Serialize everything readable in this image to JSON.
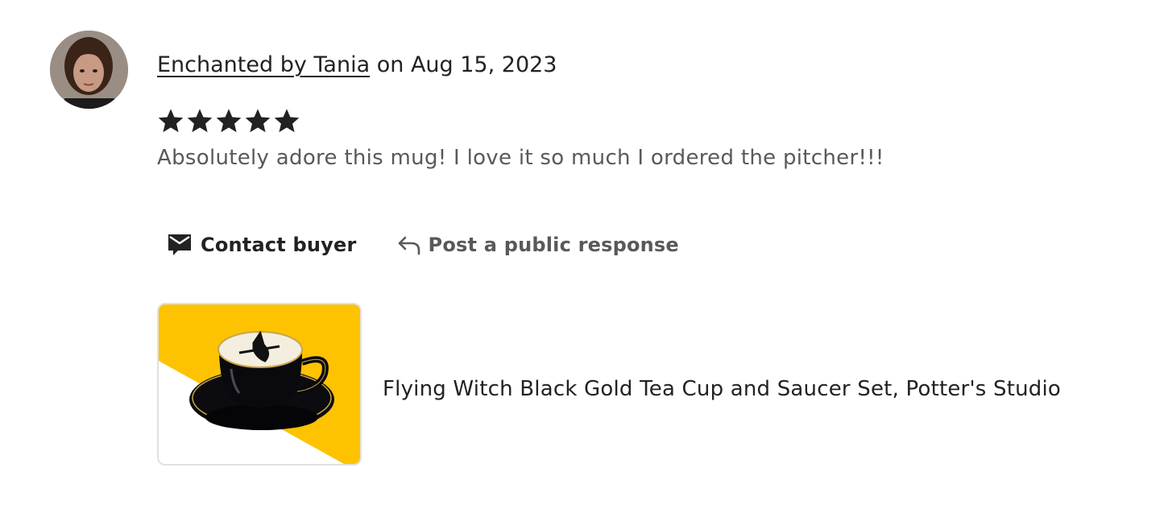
{
  "review": {
    "reviewer_name": "Enchanted by Tania",
    "date_text": "on Aug 15, 2023",
    "rating": 5,
    "rating_max": 5,
    "text": "Absolutely adore this mug! I love it so much I ordered the pitcher!!!"
  },
  "actions": {
    "contact_label": "Contact buyer",
    "contact_icon": "envelope-icon",
    "response_label": "Post a public response",
    "response_icon": "reply-arrow-icon"
  },
  "product": {
    "title": "Flying Witch Black Gold Tea Cup and Saucer Set, Potter's Studio"
  },
  "colors": {
    "text_primary": "#222222",
    "text_secondary": "#595959",
    "star": "#222222",
    "thumb_yellow": "#fdc300",
    "thumb_border": "#e1e1e1"
  }
}
